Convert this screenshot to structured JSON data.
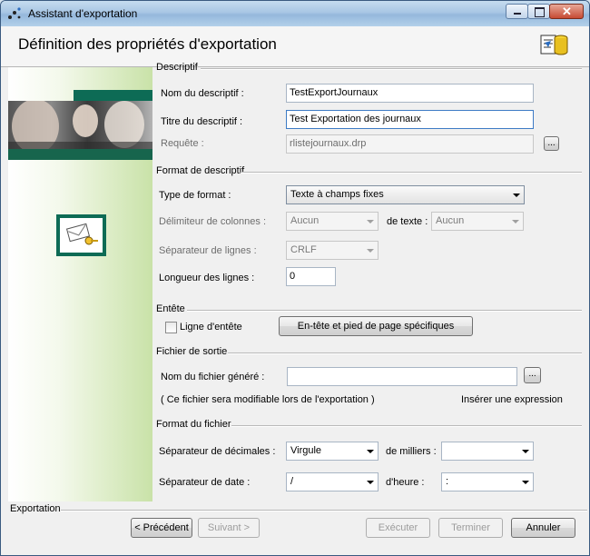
{
  "window": {
    "title": "Assistant d'exportation",
    "header_title": "Définition des propriétés d'exportation"
  },
  "icons": {
    "app": "dots-app-icon",
    "header": "export-database-icon",
    "left_panel": "envelope-key-icon"
  },
  "descriptif": {
    "section": "Descriptif",
    "nom_label": "Nom du descriptif :",
    "nom_value": "TestExportJournaux",
    "titre_label": "Titre du descriptif :",
    "titre_value": "Test Exportation des journaux",
    "requete_label": "Requête :",
    "requete_value": "rlistejournaux.drp",
    "browse_label": "..."
  },
  "format": {
    "section": "Format de descriptif",
    "type_label": "Type  de format :",
    "type_value": "Texte à champs fixes",
    "delim_col_label": "Délimiteur de colonnes :",
    "delim_col_value": "Aucun",
    "delim_texte_label": "de texte :",
    "delim_texte_value": "Aucun",
    "sep_lignes_label": "Séparateur de lignes :",
    "sep_lignes_value": "CRLF",
    "longueur_label": "Longueur des lignes :",
    "longueur_value": "0"
  },
  "entete": {
    "section": "Entête",
    "checkbox_label": "Ligne d'entête",
    "button_label": "En-tête et pied de page spécifiques"
  },
  "sortie": {
    "section": "Fichier de sortie",
    "nom_label": "Nom du fichier généré :",
    "nom_value": "",
    "browse_label": "...",
    "note": "( Ce fichier sera modifiable lors de l'exportation )",
    "insert_expr": "Insérer une expression"
  },
  "format_fichier": {
    "section": "Format du fichier",
    "sep_dec_label": "Séparateur de décimales :",
    "sep_dec_value": "Virgule",
    "milliers_label": "de milliers :",
    "milliers_value": "",
    "sep_date_label": "Séparateur de date :",
    "sep_date_value": "/",
    "heure_label": "d'heure :",
    "heure_value": ":"
  },
  "footer": {
    "group_label": "Exportation",
    "precedent": "< Précédent",
    "suivant": "Suivant >",
    "executer": "Exécuter",
    "terminer": "Terminer",
    "annuler": "Annuler"
  }
}
